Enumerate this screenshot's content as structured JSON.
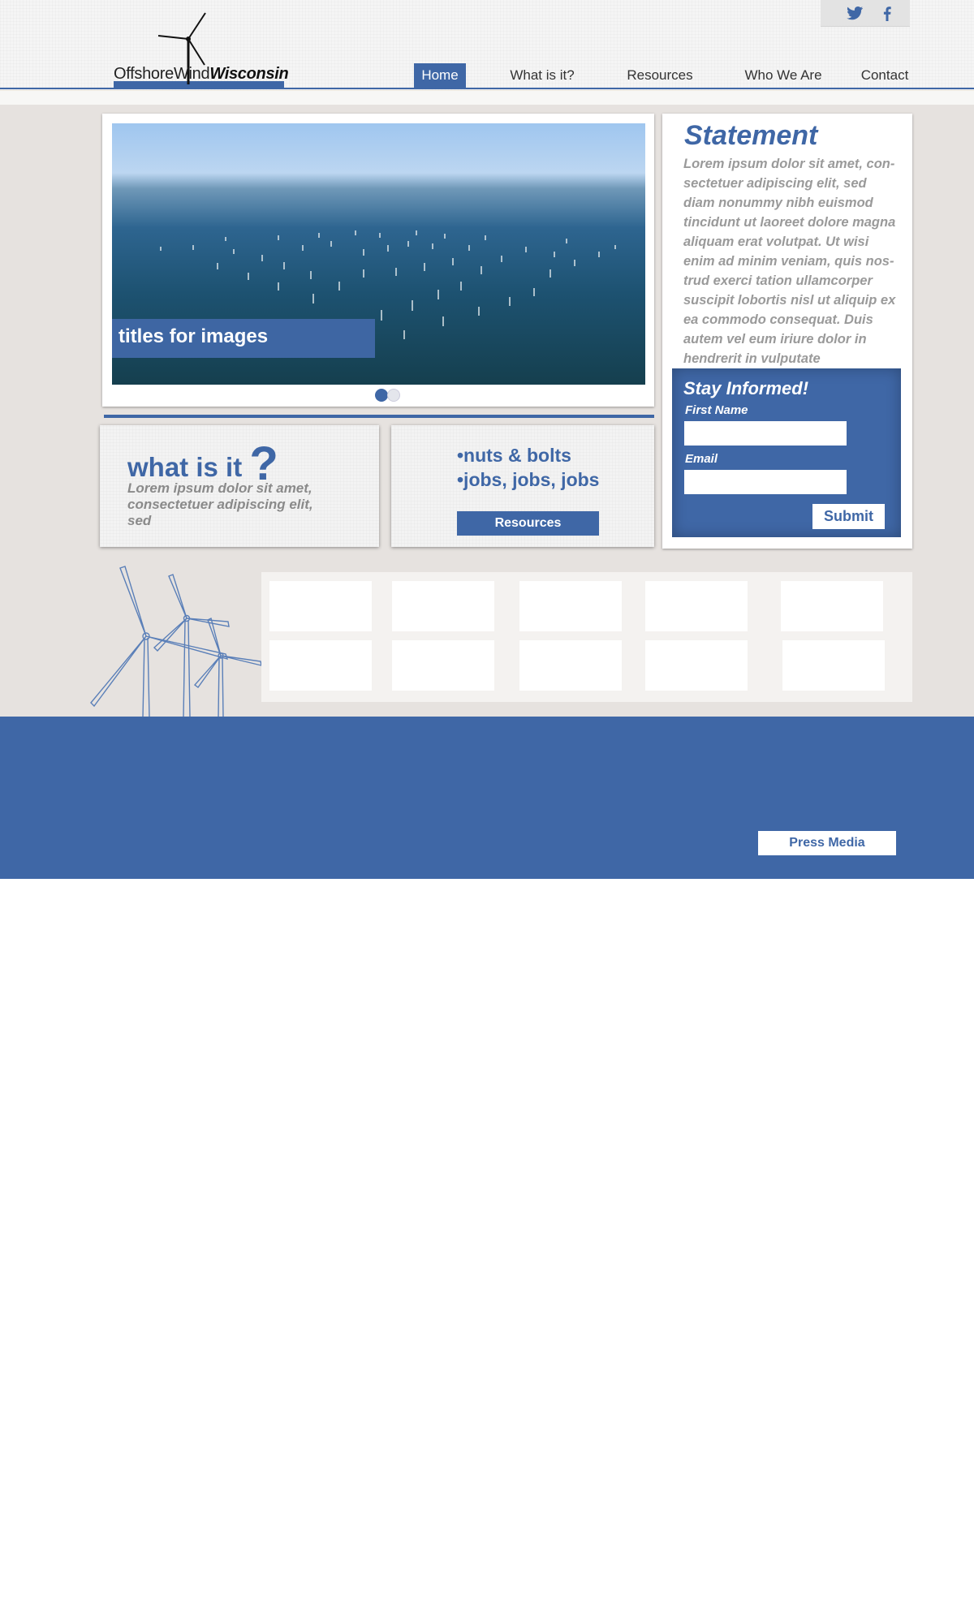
{
  "brand": {
    "logo_part1": "OffshoreWind",
    "logo_part2": "Wisconsin"
  },
  "social": {
    "icons": [
      "twitter-icon",
      "facebook-icon"
    ],
    "color": "#3f67a6"
  },
  "nav": {
    "items": [
      {
        "label": "Home",
        "active": true
      },
      {
        "label": "What is it?",
        "active": false
      },
      {
        "label": "Resources",
        "active": false
      },
      {
        "label": "Who We Are",
        "active": false
      },
      {
        "label": "Contact",
        "active": false
      }
    ]
  },
  "slider": {
    "caption": "titles for images",
    "total_slides": 2,
    "current_slide": 1
  },
  "whatis": {
    "title": "what is it",
    "mark": "?",
    "text": "Lorem ipsum dolor sit amet, consectetuer adipiscing elit, sed"
  },
  "resources_box": {
    "bullet1": "•nuts & bolts",
    "bullet2": "•jobs, jobs, jobs",
    "button": "Resources"
  },
  "statement": {
    "title": "Statement",
    "text": "Lorem ipsum dolor sit amet, con-sectetuer adipiscing elit, sed diam nonummy nibh euismod tincidunt ut laoreet dolore magna aliquam erat volutpat. Ut wisi enim ad minim veniam, quis nos-trud exerci tation ullamcorper suscipit lobortis nisl ut aliquip ex ea commodo consequat. Duis autem vel eum iriure dolor in hendrerit in vulputate"
  },
  "subscribe": {
    "title": "Stay Informed!",
    "first_name_label": "First Name",
    "first_name_value": "",
    "email_label": "Email",
    "email_value": "",
    "submit": "Submit"
  },
  "footer": {
    "press_button": "Press Media"
  },
  "colors": {
    "accent": "#3f67a6",
    "main_bg": "#e6e2df",
    "muted_text": "#9a9a9a"
  }
}
